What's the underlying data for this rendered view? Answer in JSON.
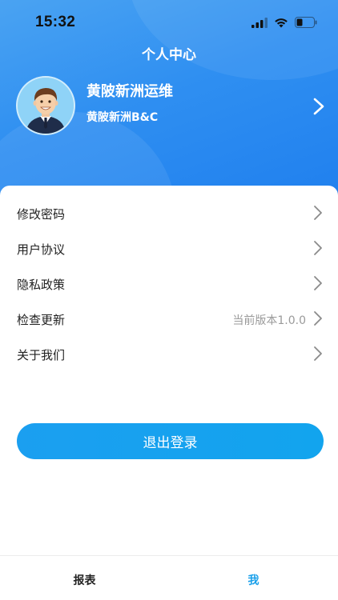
{
  "status_bar": {
    "time": "15:32"
  },
  "header": {
    "title": "个人中心"
  },
  "profile": {
    "name": "黄陂新洲运维",
    "organization": "黄陂新洲B&C",
    "avatar_icon": "male-user-avatar-icon"
  },
  "menu": {
    "items": [
      {
        "label": "修改密码",
        "value": ""
      },
      {
        "label": "用户协议",
        "value": ""
      },
      {
        "label": "隐私政策",
        "value": ""
      },
      {
        "label": "检查更新",
        "value": "当前版本1.0.0"
      },
      {
        "label": "关于我们",
        "value": ""
      }
    ]
  },
  "logout": {
    "label": "退出登录"
  },
  "tabbar": {
    "tabs": [
      {
        "label": "报表",
        "active": false
      },
      {
        "label": "我",
        "active": true
      }
    ]
  },
  "colors": {
    "accent": "#1f8cf0",
    "button": "#15a1ee",
    "tab_active": "#1aa0ea",
    "tab_inactive": "#222222"
  }
}
